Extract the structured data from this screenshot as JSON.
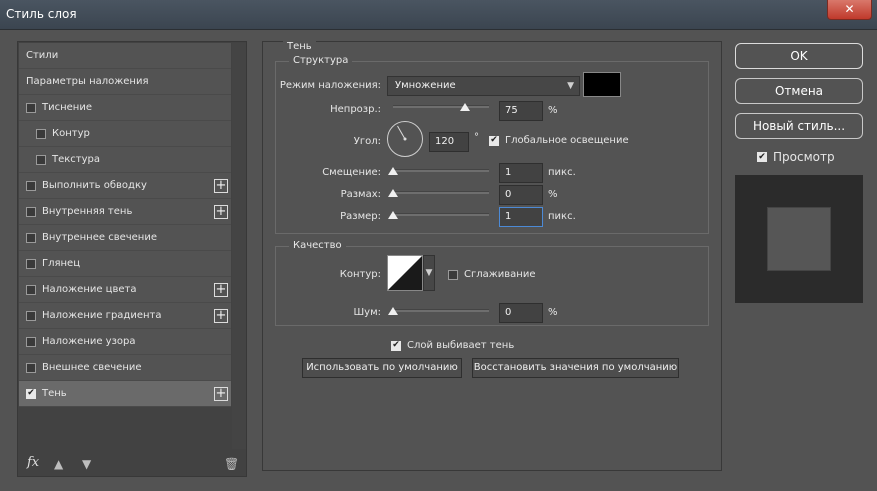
{
  "window": {
    "title": "Стиль слоя",
    "close_glyph": "✕"
  },
  "styles_list": {
    "items": [
      {
        "label": "Стили",
        "checkbox": false,
        "checked": false,
        "indent": false,
        "plus": false,
        "active": false
      },
      {
        "label": "Параметры наложения",
        "checkbox": false,
        "checked": false,
        "indent": false,
        "plus": false,
        "active": false
      },
      {
        "label": "Тиснение",
        "checkbox": true,
        "checked": false,
        "indent": false,
        "plus": false,
        "active": false
      },
      {
        "label": "Контур",
        "checkbox": true,
        "checked": false,
        "indent": true,
        "plus": false,
        "active": false
      },
      {
        "label": "Текстура",
        "checkbox": true,
        "checked": false,
        "indent": true,
        "plus": false,
        "active": false
      },
      {
        "label": "Выполнить обводку",
        "checkbox": true,
        "checked": false,
        "indent": false,
        "plus": true,
        "active": false
      },
      {
        "label": "Внутренняя тень",
        "checkbox": true,
        "checked": false,
        "indent": false,
        "plus": true,
        "active": false
      },
      {
        "label": "Внутреннее свечение",
        "checkbox": true,
        "checked": false,
        "indent": false,
        "plus": false,
        "active": false
      },
      {
        "label": "Глянец",
        "checkbox": true,
        "checked": false,
        "indent": false,
        "plus": false,
        "active": false
      },
      {
        "label": "Наложение цвета",
        "checkbox": true,
        "checked": false,
        "indent": false,
        "plus": true,
        "active": false
      },
      {
        "label": "Наложение градиента",
        "checkbox": true,
        "checked": false,
        "indent": false,
        "plus": true,
        "active": false
      },
      {
        "label": "Наложение узора",
        "checkbox": true,
        "checked": false,
        "indent": false,
        "plus": false,
        "active": false
      },
      {
        "label": "Внешнее свечение",
        "checkbox": true,
        "checked": false,
        "indent": false,
        "plus": false,
        "active": false
      },
      {
        "label": "Тень",
        "checkbox": true,
        "checked": true,
        "indent": false,
        "plus": true,
        "active": true
      }
    ],
    "plus_glyph": "+",
    "check_glyph": "✔",
    "toolbar": {
      "fx_label": "fx",
      "fx_icon": "fx-icon",
      "up_icon": "arrow-up-icon",
      "down_icon": "arrow-down-icon",
      "trash_icon": "trash-icon"
    }
  },
  "shadow": {
    "section_title": "Тень",
    "structure": {
      "group_title": "Структура",
      "blend_mode": {
        "label": "Режим наложения:",
        "value": "Умножение",
        "color": "#000000"
      },
      "opacity": {
        "label": "Непрозр.:",
        "value": "75",
        "unit": "%",
        "slider_fraction": 0.75
      },
      "angle": {
        "label": "Угол:",
        "value": "120",
        "unit": "°",
        "global_light_label": "Глобальное освещение",
        "global_light_checked": true
      },
      "distance": {
        "label": "Смещение:",
        "value": "1",
        "unit": "пикс.",
        "slider_fraction": 0.0
      },
      "spread": {
        "label": "Размах:",
        "value": "0",
        "unit": "%",
        "slider_fraction": 0.0
      },
      "size": {
        "label": "Размер:",
        "value": "1",
        "unit": "пикс.",
        "slider_fraction": 0.0
      }
    },
    "quality": {
      "group_title": "Качество",
      "contour_label": "Контур:",
      "antialias_label": "Сглаживание",
      "antialias_checked": false,
      "noise": {
        "label": "Шум:",
        "value": "0",
        "unit": "%",
        "slider_fraction": 0.0
      }
    },
    "knockout_label": "Слой выбивает тень",
    "knockout_checked": true,
    "use_default_label": "Использовать по умолчанию",
    "reset_default_label": "Восстановить значения по умолчанию"
  },
  "actions": {
    "ok_label": "OK",
    "cancel_label": "Отмена",
    "new_style_label": "Новый стиль...",
    "preview_label": "Просмотр",
    "preview_checked": true
  }
}
